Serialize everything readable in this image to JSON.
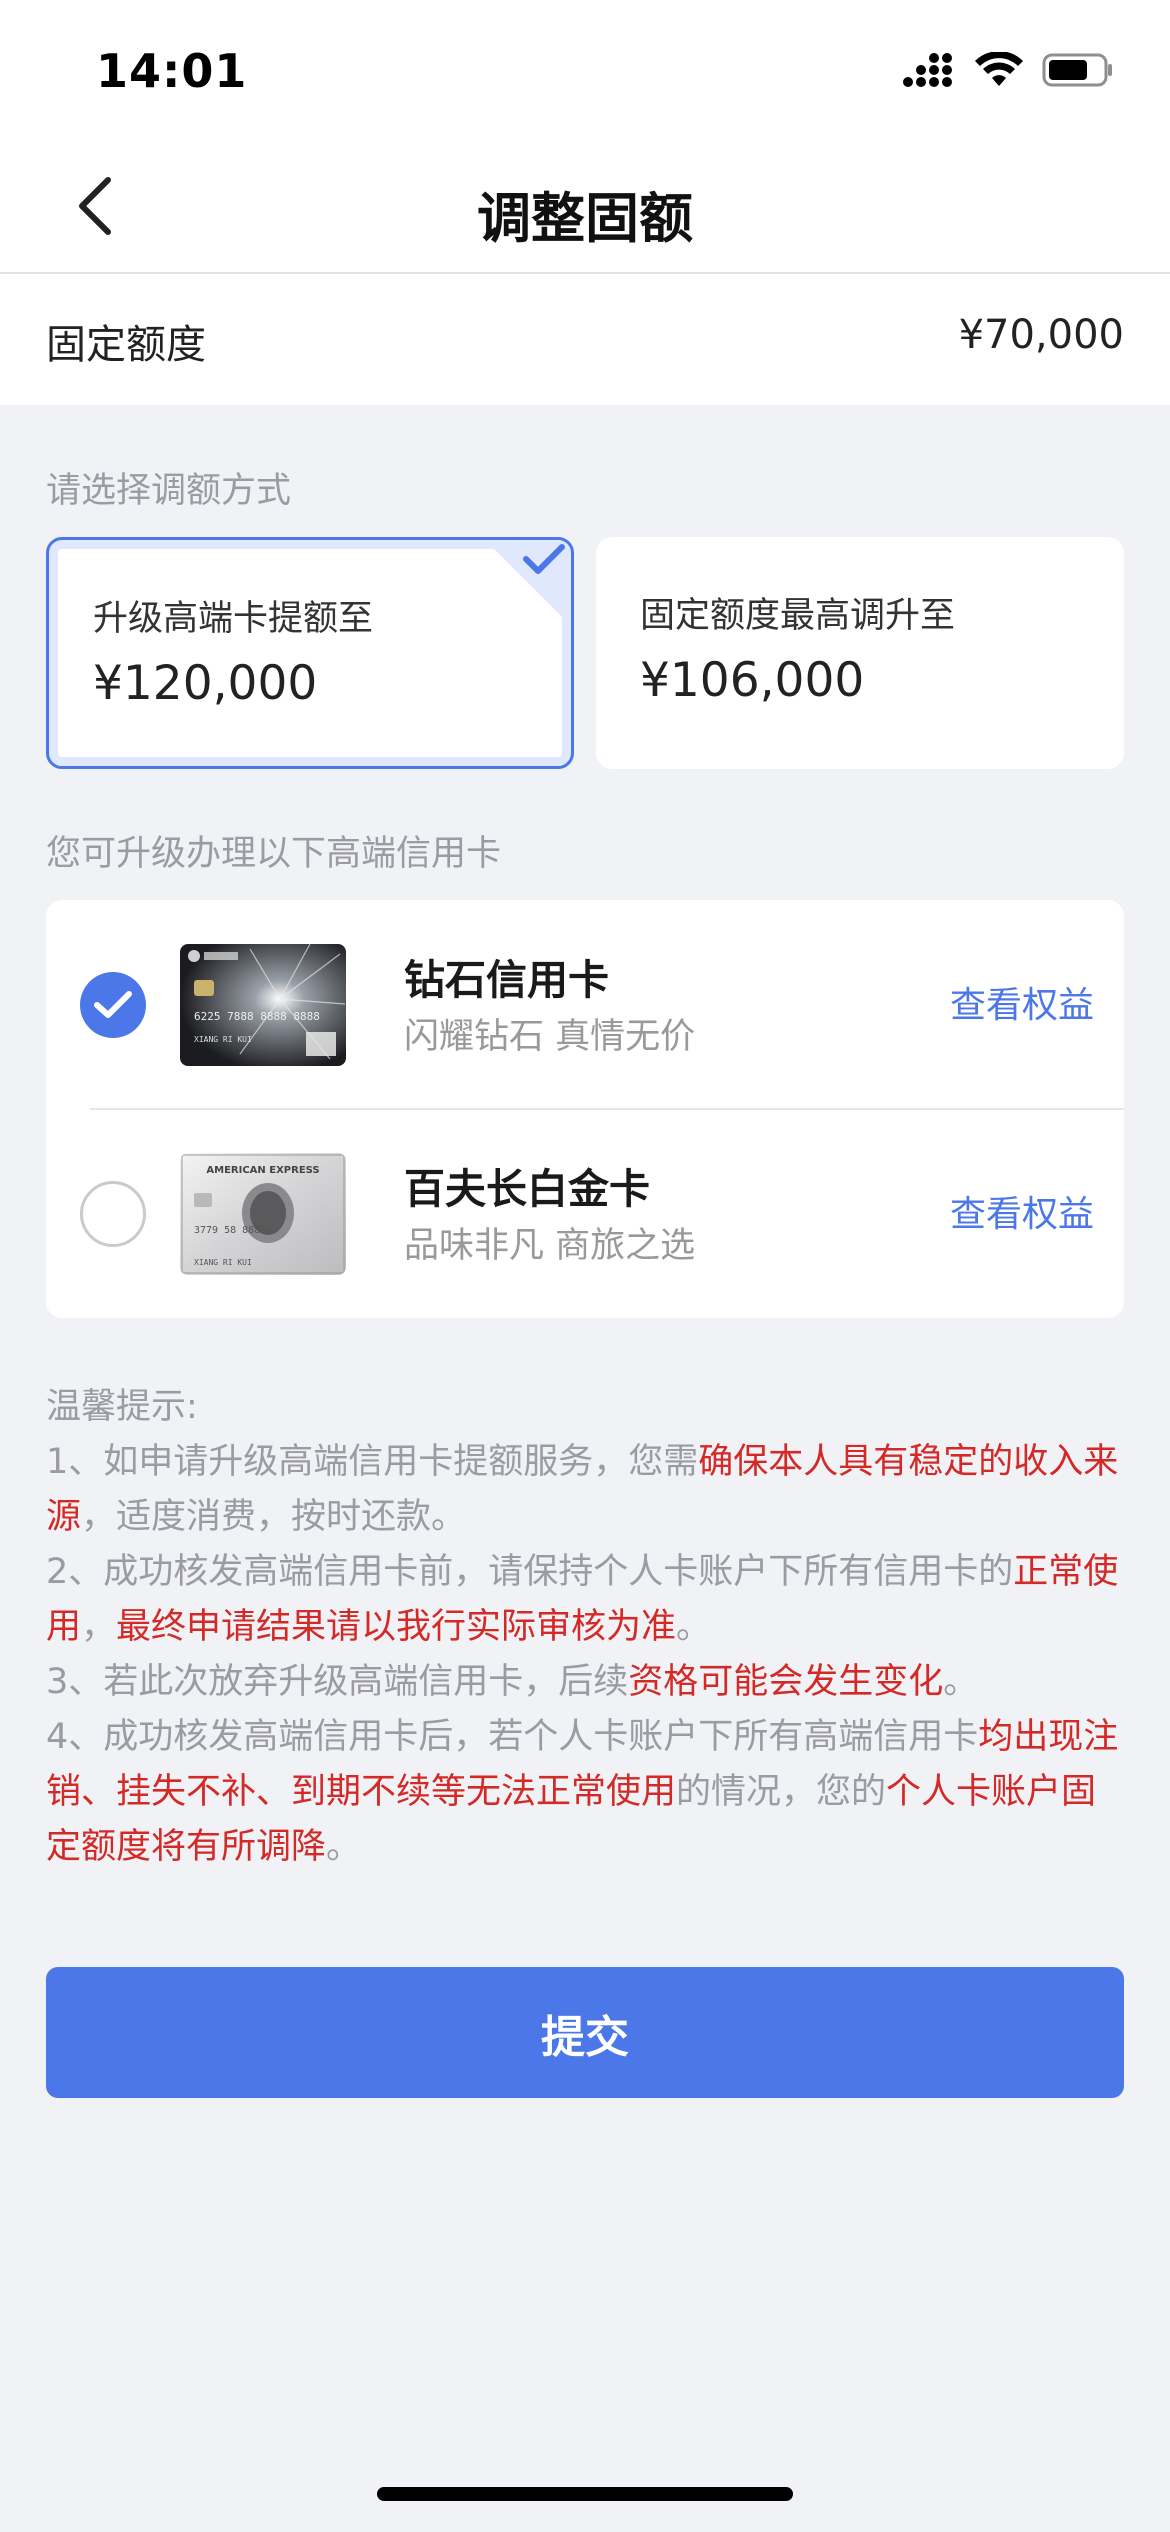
{
  "status_bar": {
    "time": "14:01"
  },
  "nav": {
    "title": "调整固额"
  },
  "quota": {
    "label": "固定额度",
    "value": "¥70,000"
  },
  "select_method": {
    "label": "请选择调额方式",
    "options": [
      {
        "title": "升级高端卡提额至",
        "amount": "¥120,000",
        "selected": true
      },
      {
        "title": "固定额度最高调升至",
        "amount": "¥106,000",
        "selected": false
      }
    ]
  },
  "upgrade": {
    "label": "您可升级办理以下高端信用卡",
    "cards": [
      {
        "name": "钻石信用卡",
        "desc": "闪耀钻石 真情无价",
        "link": "查看权益",
        "checked": true,
        "card_text": {
          "number": "6225 7888 8888 8888",
          "holder": "XIANG RI KUI"
        }
      },
      {
        "name": "百夫长白金卡",
        "desc": "品味非凡 商旅之选",
        "link": "查看权益",
        "checked": false,
        "card_text": {
          "brand": "AMERICAN EXPRESS",
          "number": "3779 58 88888",
          "holder": "XIANG RI KUI"
        }
      }
    ]
  },
  "tips": {
    "title": "温馨提示:",
    "t1a": "1、如申请升级高端信用卡提额服务，您需",
    "t1b": "确保本人具有稳定的收入来源",
    "t1c": "，适度消费，按时还款。",
    "t2a": "2、成功核发高端信用卡前，请保持个人卡账户下所有信用卡的",
    "t2b": "正常使用",
    "t2c": "，",
    "t2d": "最终申请结果请以我行实际审核为准",
    "t2e": "。",
    "t3a": "3、若此次放弃升级高端信用卡，后续",
    "t3b": "资格可能会发生变化",
    "t3c": "。",
    "t4a": "4、成功核发高端信用卡后，若个人卡账户下所有高端信用卡",
    "t4b": "均出现注销、挂失不补、到期不续等无法正常使用",
    "t4c": "的情况，您的",
    "t4d": "个人卡账户固定额度将有所调降",
    "t4e": "。"
  },
  "submit": {
    "label": "提交"
  },
  "colors": {
    "accent": "#4C77E8",
    "warning_red": "#D32A27",
    "background": "#F1F2F6"
  }
}
